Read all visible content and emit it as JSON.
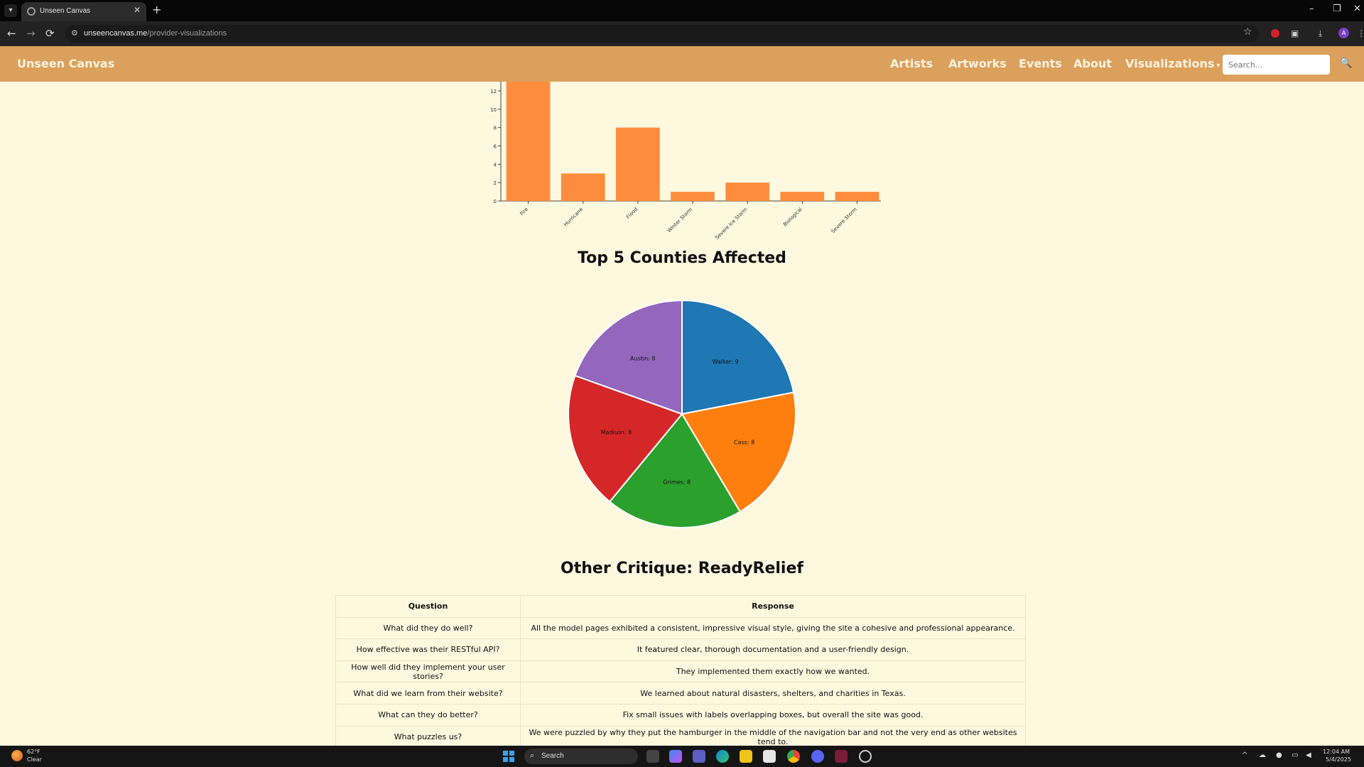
{
  "browser": {
    "tab_title": "Unseen Canvas",
    "tab_close": "✕",
    "new_tab": "+",
    "url_host": "unseencanvas.me",
    "url_path": "/provider-visualizations",
    "back_glyph": "←",
    "forward_glyph": "→",
    "reload_glyph": "⟳",
    "bookmark_glyph": "☆",
    "minimize_glyph": "–",
    "restore_glyph": "❐",
    "close_glyph": "✕",
    "profile_initial": "A",
    "icons": {
      "tab_list": "chevron-down-icon",
      "bookmark": "star-icon",
      "extensions": "puzzle-icon",
      "download": "download-icon",
      "menu": "kebab-menu-icon"
    }
  },
  "navbar": {
    "brand": "Unseen Canvas",
    "links": [
      "Artists",
      "Artworks",
      "Events",
      "About",
      "Visualizations"
    ],
    "dropdown_caret": "▾",
    "search_placeholder": "Search...",
    "search_glyph": "🔍",
    "bg_color": "#dba05c"
  },
  "chart_data": [
    {
      "type": "bar",
      "categories": [
        "Fire",
        "Hurricane",
        "Flood",
        "Winter Storm",
        "Severe Ice Storm",
        "Biological",
        "Severe Storm"
      ],
      "values": [
        13,
        3,
        8,
        1,
        2,
        1,
        1
      ],
      "yticks": [
        0,
        2,
        4,
        6,
        8,
        10,
        12
      ],
      "ylim": [
        0,
        13
      ],
      "color": "#fd8d3c",
      "title": "",
      "xlabel": "",
      "ylabel": ""
    },
    {
      "type": "pie",
      "title": "Top 5 Counties Affected",
      "slices": [
        {
          "label": "Walker: 9",
          "value": 9,
          "color": "#1f77b4"
        },
        {
          "label": "Cass: 8",
          "value": 8,
          "color": "#ff7f0e"
        },
        {
          "label": "Grimes: 8",
          "value": 8,
          "color": "#2ca02c"
        },
        {
          "label": "Madison: 8",
          "value": 8,
          "color": "#d62728"
        },
        {
          "label": "Austin: 8",
          "value": 8,
          "color": "#9467bd"
        }
      ]
    }
  ],
  "critique": {
    "title": "Other Critique: ReadyRelief",
    "headers": [
      "Question",
      "Response"
    ],
    "rows": [
      [
        "What did they do well?",
        "All the model pages exhibited a consistent, impressive visual style, giving the site a cohesive and professional appearance."
      ],
      [
        "How effective was their RESTful API?",
        "It featured clear, thorough documentation and a user-friendly design."
      ],
      [
        "How well did they implement your user stories?",
        "They implemented them exactly how we wanted."
      ],
      [
        "What did we learn from their website?",
        "We learned about natural disasters, shelters, and charities in Texas."
      ],
      [
        "What can they do better?",
        "Fix small issues with labels overlapping boxes, but overall the site was good."
      ],
      [
        "What puzzles us?",
        "We were puzzled by why they put the hamburger in the middle of the navigation bar and not the very end as other websites tend to."
      ]
    ]
  },
  "taskbar": {
    "weather_temp": "62°F",
    "weather_desc": "Clear",
    "search_label": "Search",
    "search_glyph": "⌕",
    "tray_up": "^",
    "time": "12:04 AM",
    "date": "5/4/2025"
  }
}
